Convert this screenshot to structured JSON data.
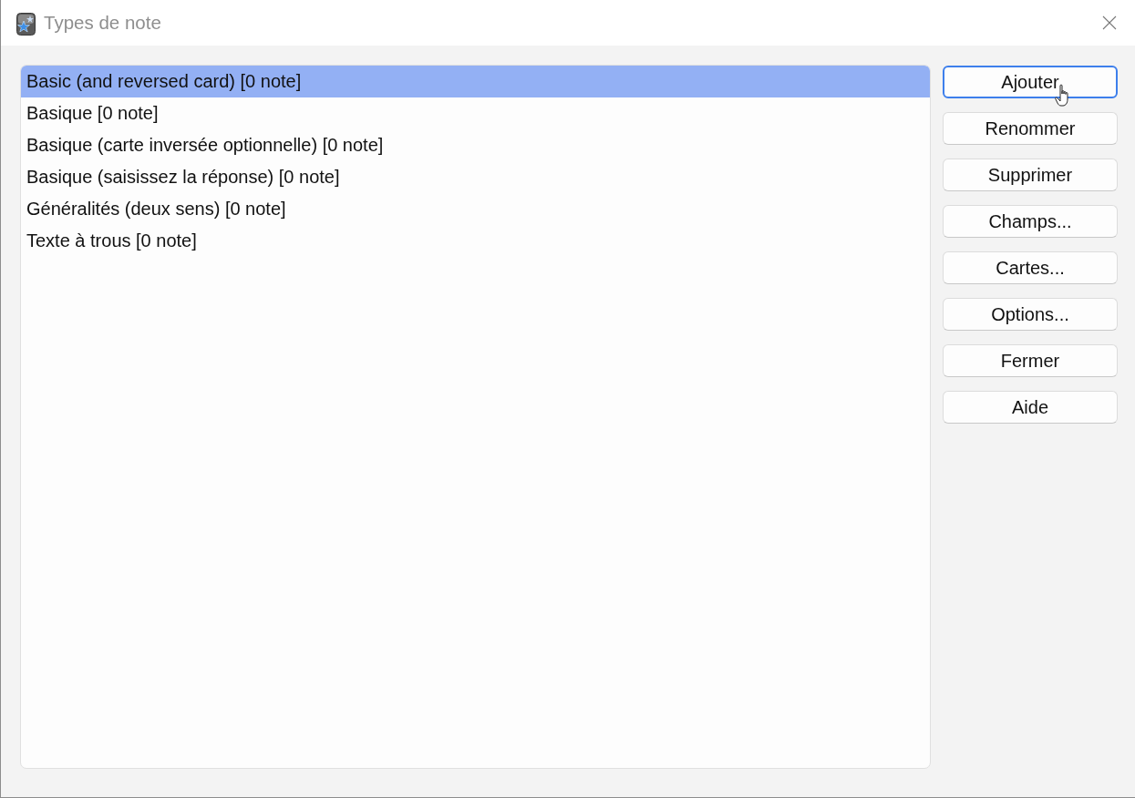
{
  "window": {
    "title": "Types de note"
  },
  "note_types": [
    {
      "label": "Basic (and reversed card) [0 note]",
      "selected": true
    },
    {
      "label": "Basique [0 note]",
      "selected": false
    },
    {
      "label": "Basique (carte inversée optionnelle) [0 note]",
      "selected": false
    },
    {
      "label": "Basique (saisissez la réponse) [0 note]",
      "selected": false
    },
    {
      "label": "Généralités (deux sens) [0 note]",
      "selected": false
    },
    {
      "label": "Texte à trous [0 note]",
      "selected": false
    }
  ],
  "buttons": [
    {
      "label": "Ajouter",
      "focused": true
    },
    {
      "label": "Renommer",
      "focused": false
    },
    {
      "label": "Supprimer",
      "focused": false
    },
    {
      "label": "Champs...",
      "focused": false
    },
    {
      "label": "Cartes...",
      "focused": false
    },
    {
      "label": "Options...",
      "focused": false
    },
    {
      "label": "Fermer",
      "focused": false
    },
    {
      "label": "Aide",
      "focused": false
    }
  ]
}
